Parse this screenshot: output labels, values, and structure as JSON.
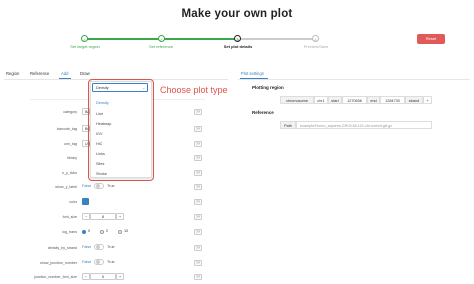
{
  "header": {
    "title": "Make your own plot",
    "reset_label": "Reset"
  },
  "steps": [
    {
      "num": "✓",
      "label": "Set target region"
    },
    {
      "num": "✓",
      "label": "Set reference"
    },
    {
      "num": "3",
      "label": "Set plot details"
    },
    {
      "num": "4",
      "label": "Preview/Save"
    }
  ],
  "tabs": {
    "left": [
      "Region",
      "Reference",
      "Add",
      "Draw"
    ],
    "right": "Plot settings"
  },
  "fields": [
    {
      "label": "category",
      "value": "Ba"
    },
    {
      "label": "barcode_tag",
      "value": "BC"
    },
    {
      "label": "umi_tag",
      "value": "UB"
    },
    {
      "label": "library",
      "value": ""
    },
    {
      "label": "n_y_ticks",
      "value": ""
    },
    {
      "label": "show_y_label",
      "false": "False",
      "true": "True"
    },
    {
      "label": "color",
      "value": ""
    },
    {
      "label": "font_size",
      "value": "8"
    },
    {
      "label": "log_trans",
      "opt_a": "0",
      "opt_b": "2",
      "opt_c": "10"
    },
    {
      "label": "density_by_strand",
      "false": "False",
      "true": "True"
    },
    {
      "label": "show_junction_number",
      "false": "False",
      "true": "True"
    },
    {
      "label": "junction_number_font_size",
      "value": "5"
    }
  ],
  "qmark": "??",
  "stepper": {
    "minus": "−",
    "plus": "+"
  },
  "dropdown": {
    "selected": "Density",
    "options": [
      "Density",
      "Line",
      "Heatmap",
      "IGV",
      "HiC",
      "Links",
      "Sites",
      "Stroke"
    ]
  },
  "callout": "Choose plot type",
  "plotting_region": {
    "title": "Plotting region",
    "chromosome_label": "chromosome",
    "chromosome": "chr1",
    "start_label": "start",
    "start": "1270656",
    "end_label": "end",
    "end": "1284730",
    "strand_label": "strand",
    "strand": "+"
  },
  "reference": {
    "title": "Reference",
    "path_label": "Path",
    "path": "example/Homo_sapiens.GRCh38.101.chr.sorted.gtf.gz"
  },
  "colors": {
    "accent": "#3b82c4",
    "red": "#e0534a",
    "green": "#3aa84a"
  }
}
